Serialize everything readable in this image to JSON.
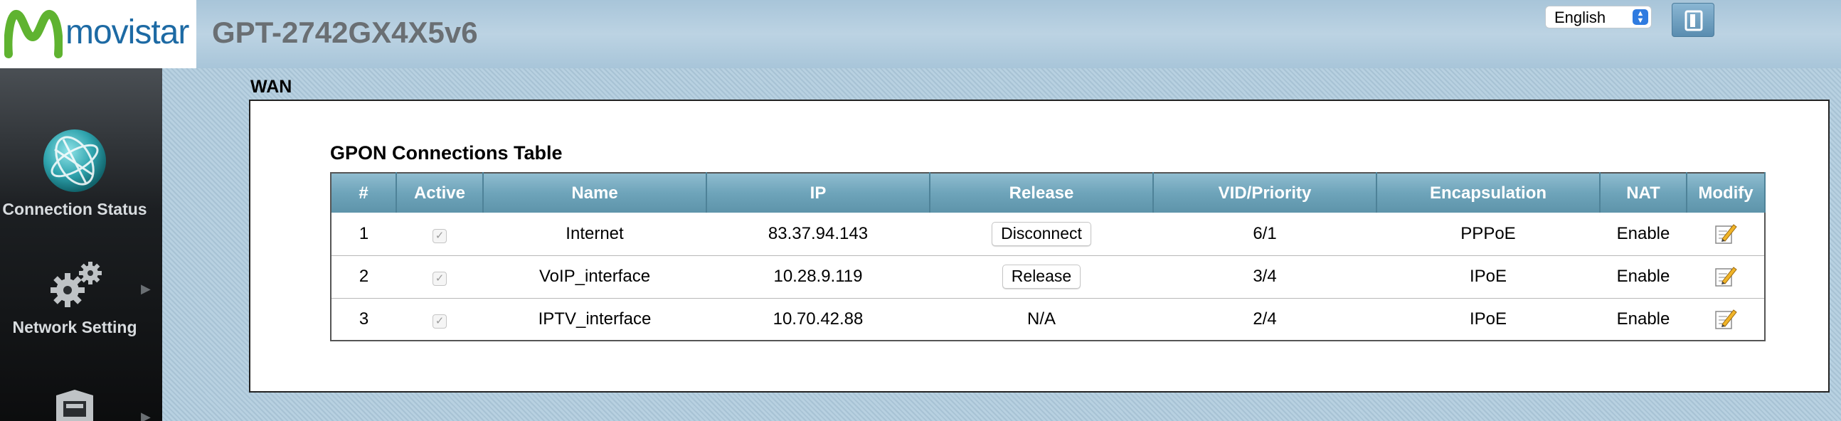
{
  "header": {
    "brand": "movistar",
    "device_name": "GPT-2742GX4X5v6",
    "language": "English",
    "logout_icon": "logout-icon"
  },
  "sidebar": {
    "items": [
      {
        "label": "Connection Status",
        "icon": "globe-icon"
      },
      {
        "label": "Network Setting",
        "icon": "gears-icon"
      },
      {
        "label": "",
        "icon": "security-shield-icon"
      }
    ]
  },
  "main": {
    "heading": "WAN",
    "table_title": "GPON Connections Table",
    "columns": [
      "#",
      "Active",
      "Name",
      "IP",
      "Release",
      "VID/Priority",
      "Encapsulation",
      "NAT",
      "Modify"
    ],
    "rows": [
      {
        "num": "1",
        "active": true,
        "name": "Internet",
        "ip": "83.37.94.143",
        "release": "Disconnect",
        "release_type": "button",
        "vid": "6/1",
        "encap": "PPPoE",
        "nat": "Enable"
      },
      {
        "num": "2",
        "active": true,
        "name": "VoIP_interface",
        "ip": "10.28.9.119",
        "release": "Release",
        "release_type": "button",
        "vid": "3/4",
        "encap": "IPoE",
        "nat": "Enable"
      },
      {
        "num": "3",
        "active": true,
        "name": "IPTV_interface",
        "ip": "10.70.42.88",
        "release": "N/A",
        "release_type": "text",
        "vid": "2/4",
        "encap": "IPoE",
        "nat": "Enable"
      }
    ]
  },
  "colors": {
    "brand_blue": "#1d6aa4",
    "brand_green": "#5fb330",
    "table_header": "#6ea4ba"
  }
}
